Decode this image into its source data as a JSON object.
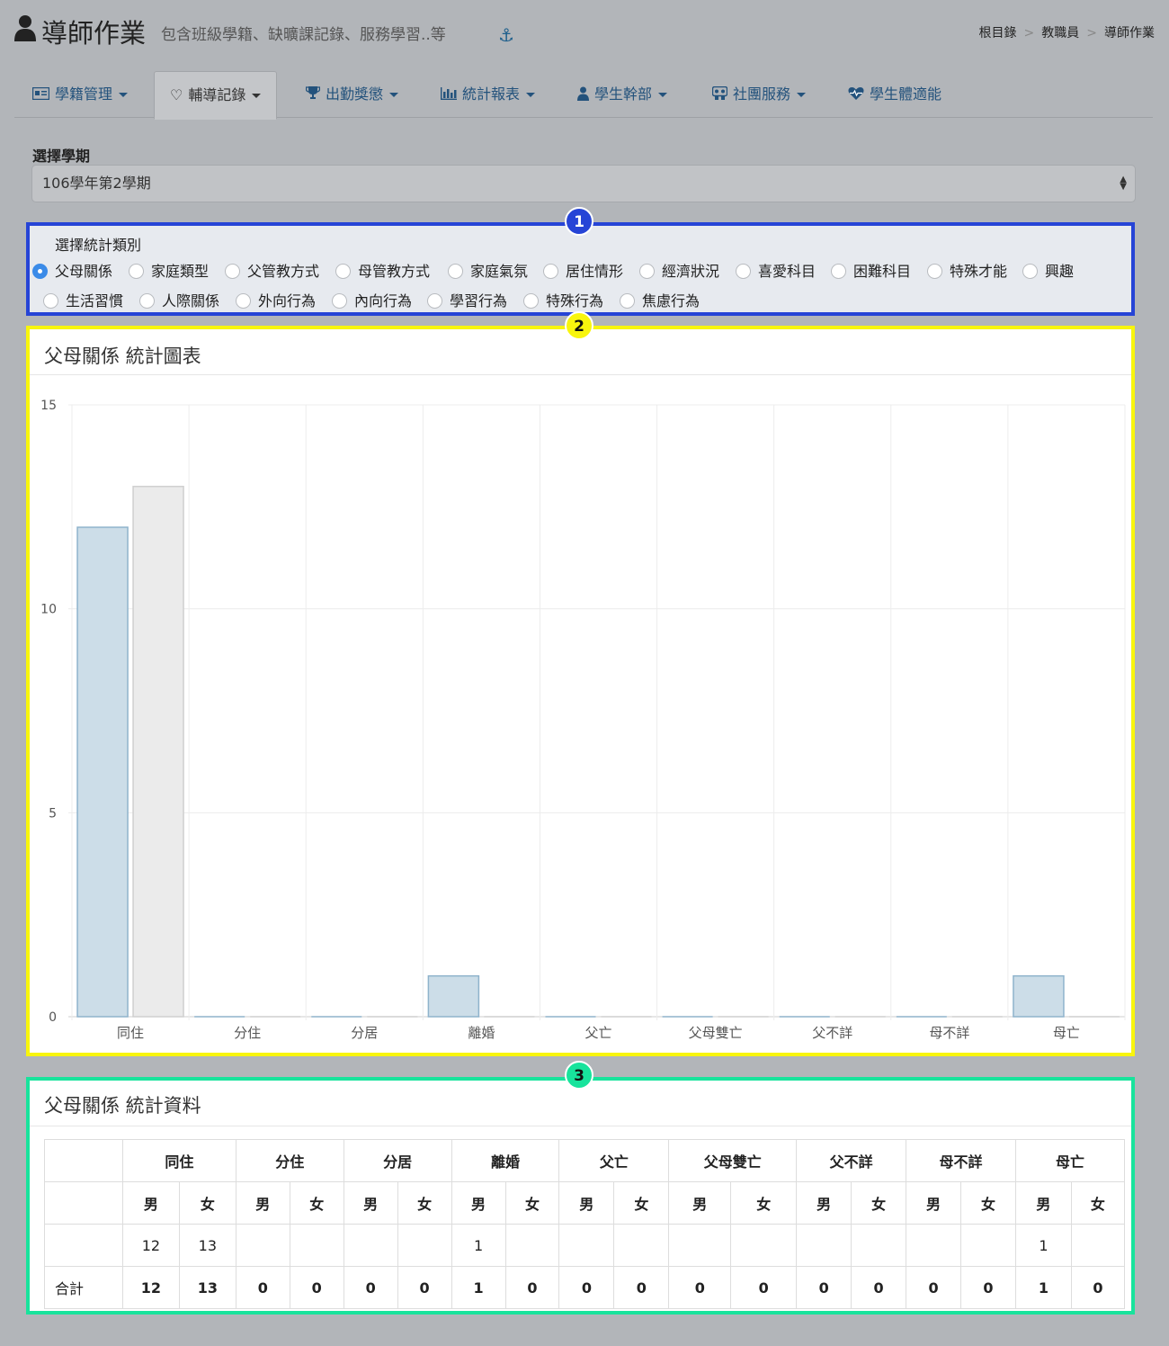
{
  "header": {
    "title": "導師作業",
    "subtitle": "包含班級學籍、缺曠課記錄、服務學習..等",
    "breadcrumb": [
      "根目錄",
      "教職員",
      "導師作業"
    ],
    "breadcrumb_sep": ">"
  },
  "tabs": [
    {
      "label": "學籍管理",
      "icon": "id-card-icon",
      "dropdown": true
    },
    {
      "label": "輔導記錄",
      "icon": "heart-icon",
      "dropdown": true,
      "active": true
    },
    {
      "label": "出勤獎懲",
      "icon": "trophy-icon",
      "dropdown": true
    },
    {
      "label": "統計報表",
      "icon": "bar-chart-icon",
      "dropdown": true
    },
    {
      "label": "學生幹部",
      "icon": "user-tie-icon",
      "dropdown": true
    },
    {
      "label": "社團服務",
      "icon": "group-icon",
      "dropdown": true
    },
    {
      "label": "學生體適能",
      "icon": "heartbeat-icon",
      "dropdown": false
    }
  ],
  "semester": {
    "label": "選擇學期",
    "value": "106學年第2學期"
  },
  "badges": {
    "one": "1",
    "two": "2",
    "three": "3"
  },
  "category": {
    "label": "選擇統計類別",
    "selected": "父母關係",
    "options": [
      "父母關係",
      "家庭類型",
      "父管教方式",
      "母管教方式",
      "家庭氣氛",
      "居住情形",
      "經濟狀況",
      "喜愛科目",
      "困難科目",
      "特殊才能",
      "興趣",
      "生活習慣",
      "人際關係",
      "外向行為",
      "內向行為",
      "學習行為",
      "特殊行為",
      "焦慮行為"
    ]
  },
  "chart_panel": {
    "title": "父母關係 統計圖表"
  },
  "chart_data": {
    "type": "bar",
    "title": "父母關係 統計圖表",
    "categories": [
      "同住",
      "分住",
      "分居",
      "離婚",
      "父亡",
      "父母雙亡",
      "父不詳",
      "母不詳",
      "母亡"
    ],
    "series": [
      {
        "name": "男",
        "values": [
          12,
          0,
          0,
          1,
          0,
          0,
          0,
          0,
          1
        ],
        "fill": "#ccdde8",
        "stroke": "#8fb3cc"
      },
      {
        "name": "女",
        "values": [
          13,
          0,
          0,
          0,
          0,
          0,
          0,
          0,
          0
        ],
        "fill": "#ebebeb",
        "stroke": "#cfcfcf"
      }
    ],
    "yticks": [
      0,
      5,
      10,
      15
    ],
    "ylim": [
      0,
      15
    ],
    "grid": true
  },
  "table_panel": {
    "title": "父母關係 統計資料"
  },
  "table": {
    "categories": [
      "同住",
      "分住",
      "分居",
      "離婚",
      "父亡",
      "父母雙亡",
      "父不詳",
      "母不詳",
      "母亡"
    ],
    "gender_labels": [
      "男",
      "女"
    ],
    "data_row": [
      "12",
      "13",
      "",
      "",
      "",
      "",
      "1",
      "",
      "",
      "",
      "",
      "",
      "",
      "",
      "",
      "",
      "1",
      ""
    ],
    "total_label": "合計",
    "total_row": [
      "12",
      "13",
      "0",
      "0",
      "0",
      "0",
      "1",
      "0",
      "0",
      "0",
      "0",
      "0",
      "0",
      "0",
      "0",
      "0",
      "1",
      "0"
    ]
  }
}
